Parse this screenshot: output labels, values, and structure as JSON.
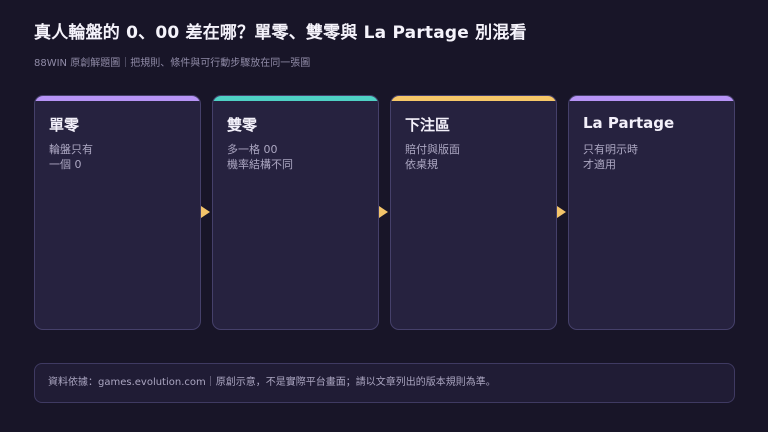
{
  "header": {
    "title": "真人輪盤的 0、00 差在哪？單零、雙零與 La Partage 別混看",
    "subtitle": "88WIN 原創解題圖｜把規則、條件與可行動步驟放在同一張圖"
  },
  "steps": [
    {
      "title": "單零",
      "line1": "輪盤只有",
      "line2": "一個 0",
      "accent": "#b794f6"
    },
    {
      "title": "雙零",
      "line1": "多一格 00",
      "line2": "機率結構不同",
      "accent": "#4fd1c5"
    },
    {
      "title": "下注區",
      "line1": "賠付與版面",
      "line2": "依桌規",
      "accent": "#f6c768"
    },
    {
      "title": "La Partage",
      "line1": "只有明示時",
      "line2": "才適用",
      "accent": "#b794f6"
    }
  ],
  "footer": {
    "note": "資料依據：games.evolution.com｜原創示意，不是實際平台畫面；請以文章列出的版本規則為準。"
  },
  "colors": {
    "background": "#181528",
    "card": "#26223f",
    "arrow": "#f3c46a"
  }
}
